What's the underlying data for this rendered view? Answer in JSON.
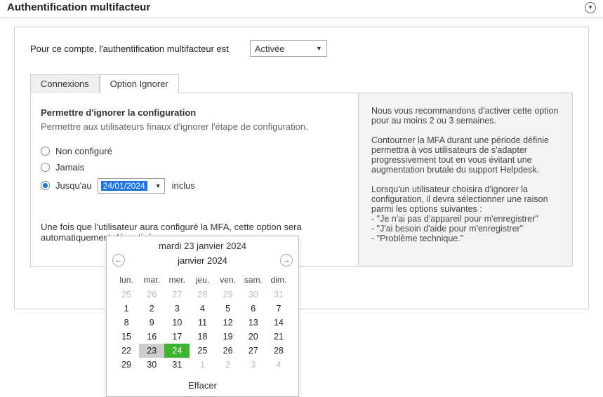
{
  "header": {
    "title": "Authentification multifacteur"
  },
  "top": {
    "label": "Pour ce compte, l'authentification multifacteur est",
    "select_value": "Activée"
  },
  "tabs": {
    "connexions": "Connexions",
    "option_ignorer": "Option Ignorer"
  },
  "section": {
    "title": "Permettre d'ignorer la configuration",
    "desc": "Permettre aux utilisateurs finaux d'ignorer l'étape de configuration."
  },
  "radios": {
    "not_configured": "Non configuré",
    "never": "Jamais",
    "until": "Jusqu'au",
    "date_value": "24/01/2024",
    "inclus": "inclus"
  },
  "after_note": "Une fois que l'utilisateur aura configuré la MFA, cette option sera automatiquement désactivée.",
  "right": {
    "p1": "Nous vous recommandons d'activer cette option pour au moins 2 ou 3 semaines.",
    "p2": "Contourner la MFA durant une période définie permettra à vos utilisateurs de s'adapter progressivement tout en vous évitant une augmentation brutale du support Helpdesk.",
    "p3_intro": "Lorsqu'un utilisateur choisira d'ignorer la configuration, il devra sélectionner une raison parmi les options suivantes :",
    "p3_l1": "- \"Je n'ai pas d'appareil pour m'enregistrer\"",
    "p3_l2": "- \"J'ai besoin d'aide pour m'enregistrer\"",
    "p3_l3": "- \"Problème technique.\""
  },
  "calendar": {
    "title": "mardi 23 janvier 2024",
    "month": "janvier 2024",
    "weekdays": [
      "lun.",
      "mar.",
      "mer.",
      "jeu.",
      "ven.",
      "sam.",
      "dim."
    ],
    "days": [
      {
        "n": "25",
        "muted": true
      },
      {
        "n": "26",
        "muted": true
      },
      {
        "n": "27",
        "muted": true
      },
      {
        "n": "28",
        "muted": true
      },
      {
        "n": "29",
        "muted": true
      },
      {
        "n": "30",
        "muted": true
      },
      {
        "n": "31",
        "muted": true
      },
      {
        "n": "1"
      },
      {
        "n": "2"
      },
      {
        "n": "3"
      },
      {
        "n": "4"
      },
      {
        "n": "5"
      },
      {
        "n": "6"
      },
      {
        "n": "7"
      },
      {
        "n": "8"
      },
      {
        "n": "9"
      },
      {
        "n": "10"
      },
      {
        "n": "11"
      },
      {
        "n": "12"
      },
      {
        "n": "13"
      },
      {
        "n": "14"
      },
      {
        "n": "15"
      },
      {
        "n": "16"
      },
      {
        "n": "17"
      },
      {
        "n": "18"
      },
      {
        "n": "19"
      },
      {
        "n": "20"
      },
      {
        "n": "21"
      },
      {
        "n": "22"
      },
      {
        "n": "23",
        "today": true
      },
      {
        "n": "24",
        "selected": true
      },
      {
        "n": "25"
      },
      {
        "n": "26"
      },
      {
        "n": "27"
      },
      {
        "n": "28"
      },
      {
        "n": "29"
      },
      {
        "n": "30"
      },
      {
        "n": "31"
      },
      {
        "n": "1",
        "muted": true
      },
      {
        "n": "2",
        "muted": true
      },
      {
        "n": "3",
        "muted": true
      },
      {
        "n": "4",
        "muted": true
      }
    ],
    "clear": "Effacer"
  }
}
